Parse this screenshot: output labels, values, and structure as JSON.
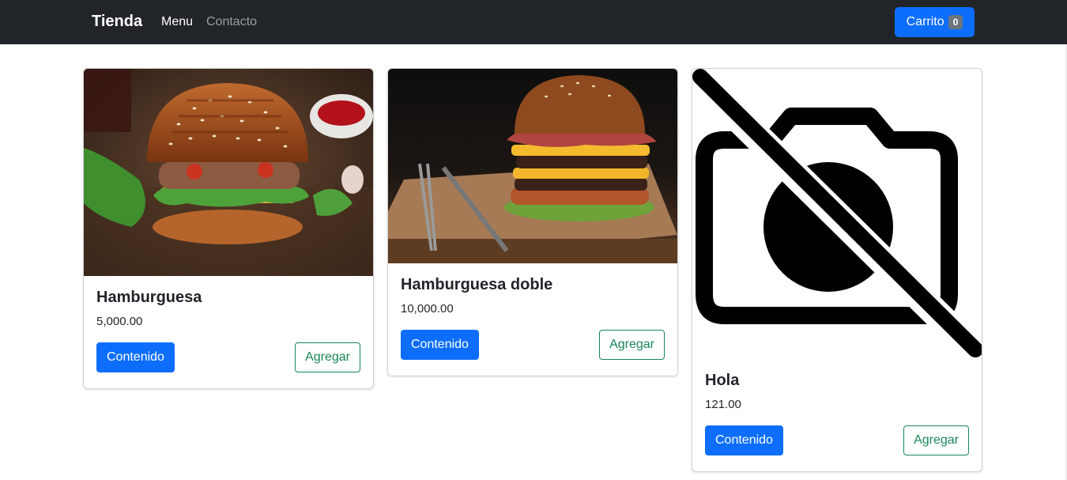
{
  "navbar": {
    "brand": "Tienda",
    "links": [
      {
        "label": "Menu"
      },
      {
        "label": "Contacto"
      }
    ],
    "cart": {
      "label": "Carrito",
      "count": "0"
    }
  },
  "products": [
    {
      "name": "Hamburguesa",
      "price": "5,000.00",
      "image": "burger-photo",
      "content_label": "Contenido",
      "add_label": "Agregar"
    },
    {
      "name": "Hamburguesa doble",
      "price": "10,000.00",
      "image": "double-burger-photo",
      "content_label": "Contenido",
      "add_label": "Agregar"
    },
    {
      "name": "Hola",
      "price": "121.00",
      "image": "no-image-icon",
      "content_label": "Contenido",
      "add_label": "Agregar"
    }
  ],
  "colors": {
    "navbar_bg": "#212529",
    "primary": "#0d6efd",
    "success_outline": "#198754",
    "badge_bg": "#6c757d"
  }
}
